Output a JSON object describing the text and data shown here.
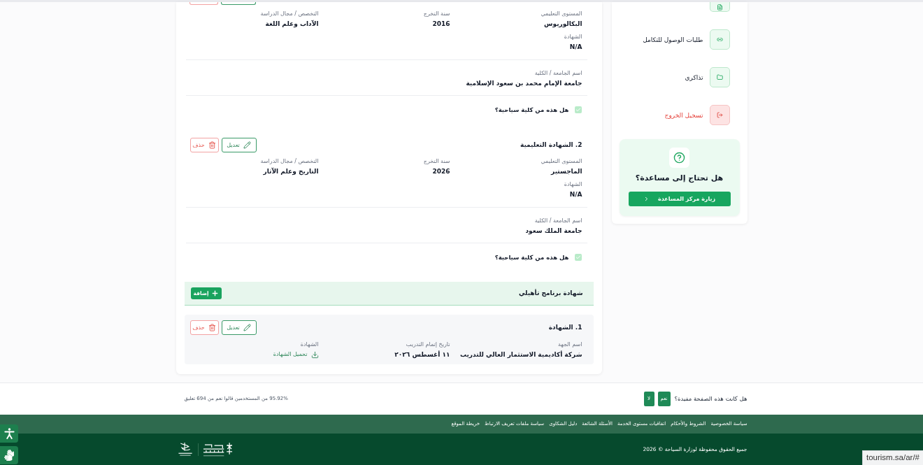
{
  "education": {
    "items": [
      {
        "actions": [
          {
            "kind": "edit"
          },
          {
            "kind": "delete"
          }
        ],
        "fields": [
          {
            "label": "المستوى التعليمي",
            "value": "البكالوريوس"
          },
          {
            "label": "سنة التخرج",
            "value": "2016"
          },
          {
            "label": "التخصص / مجال الدراسة",
            "value": "الآداب وعلم اللغة"
          },
          {
            "label": "الشهادة",
            "value": "N/A"
          }
        ],
        "university": {
          "label": "اسم الجامعة / الكلية",
          "value": "جامعة الإمام محمد بن سعود الإسلامية"
        },
        "tourism_college": {
          "question": "هل هذه من كلية سياحية؟",
          "checked": true
        }
      },
      {
        "title": "2. الشهادة التعليمية",
        "actions": [
          {
            "kind": "edit",
            "label": "تعديل"
          },
          {
            "kind": "delete",
            "label": "حذف"
          }
        ],
        "fields": [
          {
            "label": "المستوى التعليمي",
            "value": "الماجستير"
          },
          {
            "label": "سنة التخرج",
            "value": "2026"
          },
          {
            "label": "التخصص / مجال الدراسة",
            "value": "التاريخ وعلم الآثار"
          },
          {
            "label": "الشهادة",
            "value": "N/A"
          }
        ],
        "university": {
          "label": "اسم الجامعة / الكلية",
          "value": "جامعة الملك سعود"
        },
        "tourism_college": {
          "question": "هل هذه من كلية سياحية؟",
          "checked": true
        }
      }
    ]
  },
  "qualifications": {
    "title": "شهادة برنامج تأهيلي",
    "add_button": "إضافة",
    "items": [
      {
        "title": "1. الشهادة",
        "actions": [
          {
            "kind": "edit",
            "label": "تعديل"
          },
          {
            "kind": "delete",
            "label": "حذف"
          }
        ],
        "fields": [
          {
            "kind": "text",
            "label": "اسم الجهة",
            "value": "شركة أكاديمية الاستثمار العالي للتدريب"
          },
          {
            "kind": "text",
            "label": "تاريخ إتمام التدريب",
            "value": "١١ أغسطس ٢٠٢٦"
          },
          {
            "kind": "download",
            "label": "الشهادة",
            "value": "تحميل الشهادة"
          }
        ]
      }
    ]
  },
  "sidebar": {
    "items": [
      {
        "kind": "link"
      },
      {
        "kind": "link",
        "label": "طلبات الوصول للتكامل"
      },
      {
        "kind": "link",
        "label": "تذاكري"
      },
      {
        "kind": "danger",
        "label": "تسجيل الخروج"
      }
    ],
    "help": {
      "title": "هل تحتاج إلى مساعدة؟",
      "button": "زيارة مركز المساعدة"
    }
  },
  "feedback": {
    "question": "هل كانت هذه الصفحة مفيدة؟",
    "buttons": [
      "نعم",
      "لا"
    ],
    "stats": "95.92% من المستخدمين قالوا نعم من 694 تعليق"
  },
  "footer": {
    "links": [
      "سياسة الخصوصية",
      "الشروط والأحكام",
      "اتفاقيات مستوى الخدمة",
      "الأسئلة الشائعة",
      "دليل الشكاوى",
      "سياسة ملفات تعريف الارتباط",
      "خريطة الموقع"
    ],
    "copyright": "جميع الحقوق محفوظة لوزارة السياحة © 2026"
  },
  "status_url": "tourism.sa/ar/#"
}
